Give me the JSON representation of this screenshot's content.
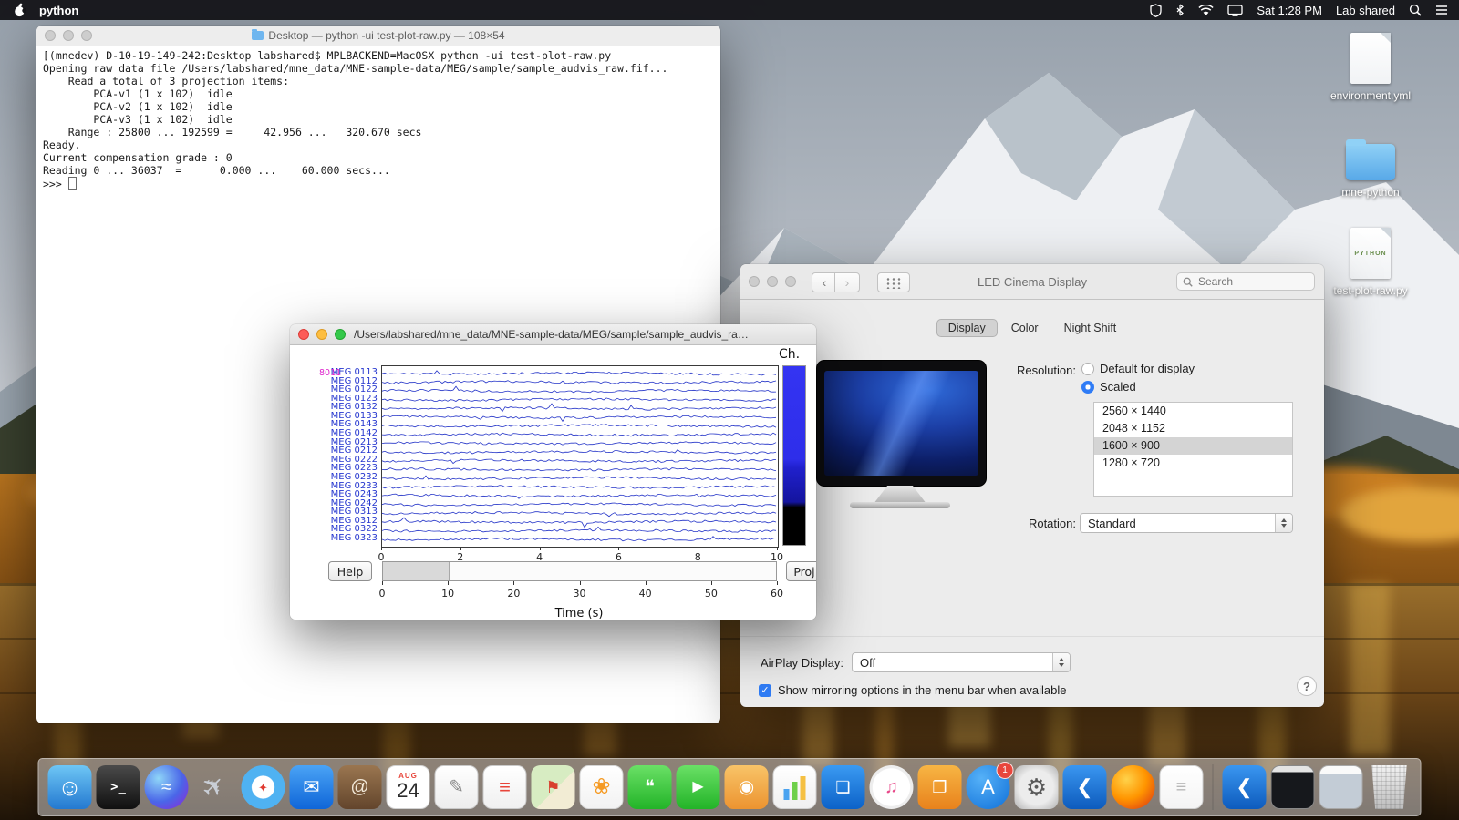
{
  "menubar": {
    "app_name": "python",
    "time": "Sat 1:28 PM",
    "user": "Lab shared"
  },
  "terminal": {
    "title": "Desktop — python -ui test-plot-raw.py — 108×54",
    "lines": [
      "[(mnedev) D-10-19-149-242:Desktop labshared$ MPLBACKEND=MacOSX python -ui test-plot-raw.py",
      "Opening raw data file /Users/labshared/mne_data/MNE-sample-data/MEG/sample/sample_audvis_raw.fif...",
      "    Read a total of 3 projection items:",
      "        PCA-v1 (1 x 102)  idle",
      "        PCA-v2 (1 x 102)  idle",
      "        PCA-v3 (1 x 102)  idle",
      "    Range : 25800 ... 192599 =     42.956 ...   320.670 secs",
      "Ready.",
      "Current compensation grade : 0",
      "Reading 0 ... 36037  =      0.000 ...    60.000 secs...",
      ">>> "
    ]
  },
  "plot_window": {
    "title": "/Users/labshared/mne_data/MNE-sample-data/MEG/sample/sample_audvis_raw.fif",
    "ch_label": "Ch.",
    "scale_annotation": "8011",
    "help_label": "Help",
    "proj_label": "Proj",
    "xlabel": "Time (s)",
    "trace_color": "#2434c8",
    "channels": [
      "MEG 0113",
      "MEG 0112",
      "MEG 0122",
      "MEG 0123",
      "MEG 0132",
      "MEG 0133",
      "MEG 0143",
      "MEG 0142",
      "MEG 0213",
      "MEG 0212",
      "MEG 0222",
      "MEG 0223",
      "MEG 0232",
      "MEG 0233",
      "MEG 0243",
      "MEG 0242",
      "MEG 0313",
      "MEG 0312",
      "MEG 0322",
      "MEG 0323"
    ],
    "top_axis_ticks": [
      "0",
      "2",
      "4",
      "6",
      "8",
      "10"
    ],
    "bottom_axis_ticks": [
      "0",
      "10",
      "20",
      "30",
      "40",
      "50",
      "60"
    ]
  },
  "prefs": {
    "title": "LED Cinema Display",
    "search_placeholder": "Search",
    "tabs": [
      {
        "label": "Display"
      },
      {
        "label": "Color"
      },
      {
        "label": "Night Shift"
      }
    ],
    "resolution_label": "Resolution:",
    "radio_default": "Default for display",
    "radio_scaled": "Scaled",
    "resolutions": [
      "2560 × 1440",
      "2048 × 1152",
      "1600 × 900",
      "1280 × 720"
    ],
    "selected_resolution": "1600 × 900",
    "rotation_label": "Rotation:",
    "rotation_value": "Standard",
    "airplay_label": "AirPlay Display:",
    "airplay_value": "Off",
    "mirroring_checkbox": "Show mirroring options in the menu bar when available",
    "help_button": "?"
  },
  "desktop_icons": [
    {
      "label": "environment.yml"
    },
    {
      "label": "mne-python"
    },
    {
      "label": "test-plot-raw.py",
      "badge": "PYTHON"
    }
  ],
  "dock": {
    "items": [
      {
        "name": "finder",
        "glyph": "☺",
        "fg": "#ffffff",
        "bg": "linear-gradient(180deg,#6ec6f5,#2479d0)",
        "shape": "square",
        "size": 26
      },
      {
        "name": "terminal",
        "glyph": ">_",
        "fg": "#ffffff",
        "bg": "linear-gradient(180deg,#4a4a4a,#101010)",
        "shape": "square",
        "size": 14,
        "mono": true
      },
      {
        "name": "siri",
        "glyph": "≈",
        "fg": "#ffffff",
        "bg": "radial-gradient(circle at 32% 30%,#8fd6f8,#4a66e8 55%,#8a2bd8 95%)",
        "shape": "circle",
        "size": 20
      },
      {
        "name": "launchpad",
        "glyph": "✈",
        "fg": "#c9ced6",
        "bg": "none",
        "shape": "circle",
        "size": 30,
        "rot": -45
      },
      {
        "name": "safari",
        "glyph": "✦",
        "fg": "#e03a30",
        "bg": "radial-gradient(circle,#ffffff 0 36%,#4fb2f2 38% 100%)",
        "shape": "circle",
        "size": 13
      },
      {
        "name": "mail",
        "glyph": "✉",
        "fg": "#ffffff",
        "bg": "linear-gradient(180deg,#4aa3f5,#0f66d8)",
        "shape": "square",
        "size": 22
      },
      {
        "name": "contacts",
        "glyph": "@",
        "fg": "#f2e8d8",
        "bg": "linear-gradient(180deg,#9a7650,#63452c)",
        "shape": "square",
        "size": 20
      },
      {
        "name": "calendar",
        "type": "calendar",
        "month": "AUG",
        "day": "24"
      },
      {
        "name": "textedit",
        "glyph": "✎",
        "fg": "#8a8a8a",
        "bg": "linear-gradient(180deg,#ffffff,#ededed)",
        "shape": "square",
        "size": 20,
        "border": "1px solid #c9c9c9"
      },
      {
        "name": "reminders",
        "glyph": "≡",
        "fg": "#e8453a",
        "bg": "linear-gradient(180deg,#ffffff,#f0f0f0)",
        "shape": "square",
        "size": 22,
        "border": "1px solid #c9c9c9"
      },
      {
        "name": "maps",
        "glyph": "⚑",
        "fg": "#d8402e",
        "bg": "linear-gradient(135deg,#d7ecc2 0 55%,#f2ecd4 55%)",
        "shape": "square",
        "size": 18
      },
      {
        "name": "photos",
        "glyph": "❀",
        "fg": "#f59a23",
        "bg": "linear-gradient(180deg,#ffffff,#f2f2f2)",
        "shape": "square",
        "size": 24,
        "border": "1px solid #d4d4d4"
      },
      {
        "name": "messages",
        "glyph": "❝",
        "fg": "#ffffff",
        "bg": "linear-gradient(180deg,#6ae066,#23b428)",
        "shape": "square",
        "size": 20
      },
      {
        "name": "facetime",
        "glyph": "▶",
        "fg": "#ffffff",
        "bg": "linear-gradient(180deg,#6ae066,#23b428)",
        "shape": "square",
        "size": 16
      },
      {
        "name": "photo-booth",
        "glyph": "◉",
        "fg": "#ffffff",
        "bg": "linear-gradient(180deg,#f8c468,#ec9430)",
        "shape": "square",
        "size": 20
      },
      {
        "name": "numbers",
        "type": "bars",
        "bg": "linear-gradient(180deg,#ffffff,#f0f0f0)",
        "border": "1px solid #d0d0d0"
      },
      {
        "name": "keynote",
        "glyph": "❏",
        "fg": "#ffffff",
        "bg": "linear-gradient(180deg,#3a9af2,#0c62c8)",
        "shape": "square",
        "size": 18
      },
      {
        "name": "itunes",
        "glyph": "♫",
        "fg": "#e84a8a",
        "bg": "radial-gradient(circle,#ffffff 0 60%,#ededed 62% 100%)",
        "shape": "circle",
        "size": 20
      },
      {
        "name": "books",
        "glyph": "❐",
        "fg": "#ffffff",
        "bg": "linear-gradient(180deg,#f7b544,#e8821c)",
        "shape": "square",
        "size": 18
      },
      {
        "name": "app-store",
        "glyph": "A",
        "fg": "#ffffff",
        "bg": "radial-gradient(circle at 35% 30%,#55b1f8,#1070d8)",
        "shape": "circle",
        "size": 22,
        "badge": "1"
      },
      {
        "name": "system-preferences",
        "glyph": "⚙",
        "fg": "#5a5a5a",
        "bg": "radial-gradient(circle,#ececec 0 55%,#b0b0b0 100%)",
        "shape": "square",
        "size": 26
      },
      {
        "name": "vscode",
        "glyph": "❮",
        "fg": "#ffffff",
        "bg": "linear-gradient(180deg,#3a96f0,#0d5bbd)",
        "shape": "square",
        "size": 22
      },
      {
        "name": "firefox",
        "glyph": "",
        "bg": "radial-gradient(circle at 35% 32%,#ffd24a,#ff9500 48%,#e8590c 78%,#c13a10 100%)",
        "shape": "circle"
      },
      {
        "name": "document",
        "glyph": "≡",
        "fg": "#b8b8b8",
        "bg": "linear-gradient(180deg,#ffffff,#f4f4f4)",
        "shape": "square",
        "size": 20,
        "border": "1px solid #cfcfcf"
      },
      {
        "type": "separator"
      },
      {
        "name": "vscode-window",
        "glyph": "❮",
        "fg": "#ffffff",
        "bg": "linear-gradient(180deg,#3a96f0,#0d5bbd)",
        "shape": "square",
        "size": 22
      },
      {
        "name": "terminal-window",
        "type": "window",
        "bg": "linear-gradient(180deg,#e4e4e4 0 14%,#16181c 14%)",
        "border": "1px solid #888888"
      },
      {
        "name": "app-window",
        "type": "window",
        "bg": "linear-gradient(180deg,#fafafa 0 18%,#c3ccd6 18%)",
        "border": "1px solid #a8a8a8"
      },
      {
        "name": "trash",
        "type": "trash"
      }
    ]
  }
}
